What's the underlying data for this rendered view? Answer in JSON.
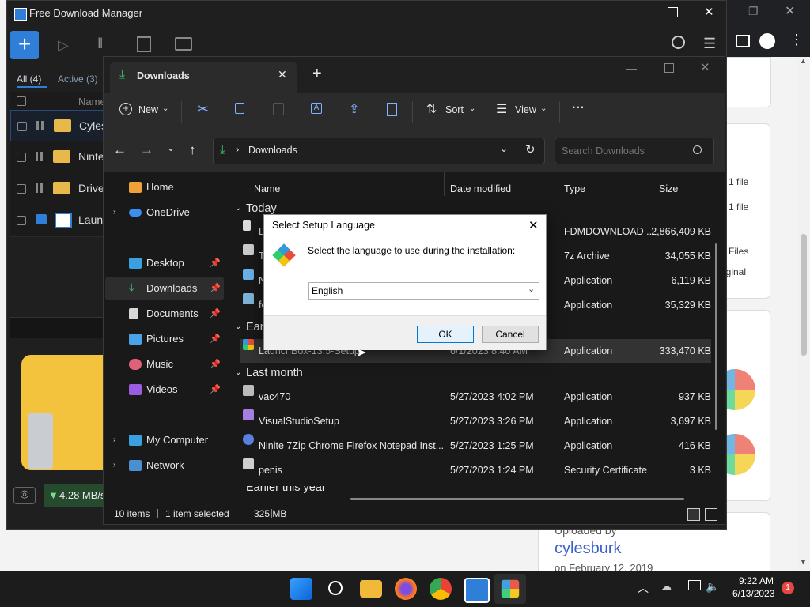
{
  "browser": {
    "right_cards": [
      {
        "text1": "1 file",
        "text2": "1 file"
      },
      {
        "text1": "Files",
        "text2": "iginal"
      }
    ],
    "uploaded_by_label": "Uploaded by",
    "uploader": "cylesburk",
    "uploaded_on": "on February 12, 2019"
  },
  "fdm": {
    "title": "Free Download Manager",
    "filter_all": "All (4)",
    "filter_active": "Active (3)",
    "col_name": "Name",
    "rows": [
      {
        "name": "Cyles"
      },
      {
        "name": "Ninte"
      },
      {
        "name": "Drive"
      },
      {
        "name": "Launc"
      }
    ],
    "speed": "4.28 MB/s"
  },
  "explorer": {
    "tab_title": "Downloads",
    "cmd": {
      "new": "New",
      "sort": "Sort",
      "view": "View",
      "more": "···"
    },
    "address": "Downloads",
    "search_placeholder": "Search Downloads",
    "nav": {
      "home": "Home",
      "onedrive": "OneDrive",
      "desktop": "Desktop",
      "downloads": "Downloads",
      "documents": "Documents",
      "pictures": "Pictures",
      "music": "Music",
      "videos": "Videos",
      "mycomputer": "My Computer",
      "network": "Network"
    },
    "columns": {
      "name": "Name",
      "date": "Date modified",
      "type": "Type",
      "size": "Size"
    },
    "groups": {
      "today": "Today",
      "earlier": "Earl",
      "last_month": "Last month",
      "earlier_year": "Earlier this year"
    },
    "today_rows": [
      {
        "name": "D",
        "date": "",
        "type": "FDMDOWNLOAD ...",
        "size": "2,866,409 KB"
      },
      {
        "name": "T",
        "date": "",
        "type": "7z Archive",
        "size": "34,055 KB"
      },
      {
        "name": "N",
        "date": "",
        "type": "Application",
        "size": "6,119 KB"
      },
      {
        "name": "fo",
        "date": "",
        "type": "Application",
        "size": "35,329 KB"
      }
    ],
    "earlier_rows": [
      {
        "name": "LaunchBox-13.5-Setup",
        "date": "6/1/2023 8:40 AM",
        "type": "Application",
        "size": "333,470 KB"
      }
    ],
    "last_month_rows": [
      {
        "name": "vac470",
        "date": "5/27/2023 4:02 PM",
        "type": "Application",
        "size": "937 KB"
      },
      {
        "name": "VisualStudioSetup",
        "date": "5/27/2023 3:26 PM",
        "type": "Application",
        "size": "3,697 KB"
      },
      {
        "name": "Ninite 7Zip Chrome Firefox Notepad Inst...",
        "date": "5/27/2023 1:25 PM",
        "type": "Application",
        "size": "416 KB"
      },
      {
        "name": "penis",
        "date": "5/27/2023 1:24 PM",
        "type": "Security Certificate",
        "size": "3 KB"
      }
    ],
    "status": {
      "items": "10 items",
      "selected": "1 item selected",
      "size": "325 MB"
    }
  },
  "dialog": {
    "title": "Select Setup Language",
    "message": "Select the language to use during the installation:",
    "language": "English",
    "ok": "OK",
    "cancel": "Cancel"
  },
  "taskbar": {
    "time": "9:22 AM",
    "date": "6/13/2023",
    "badge": "1"
  },
  "colors": {
    "accent": "#2f7fd8",
    "download_green": "#3fbf6f",
    "dark_bg": "#191919"
  }
}
